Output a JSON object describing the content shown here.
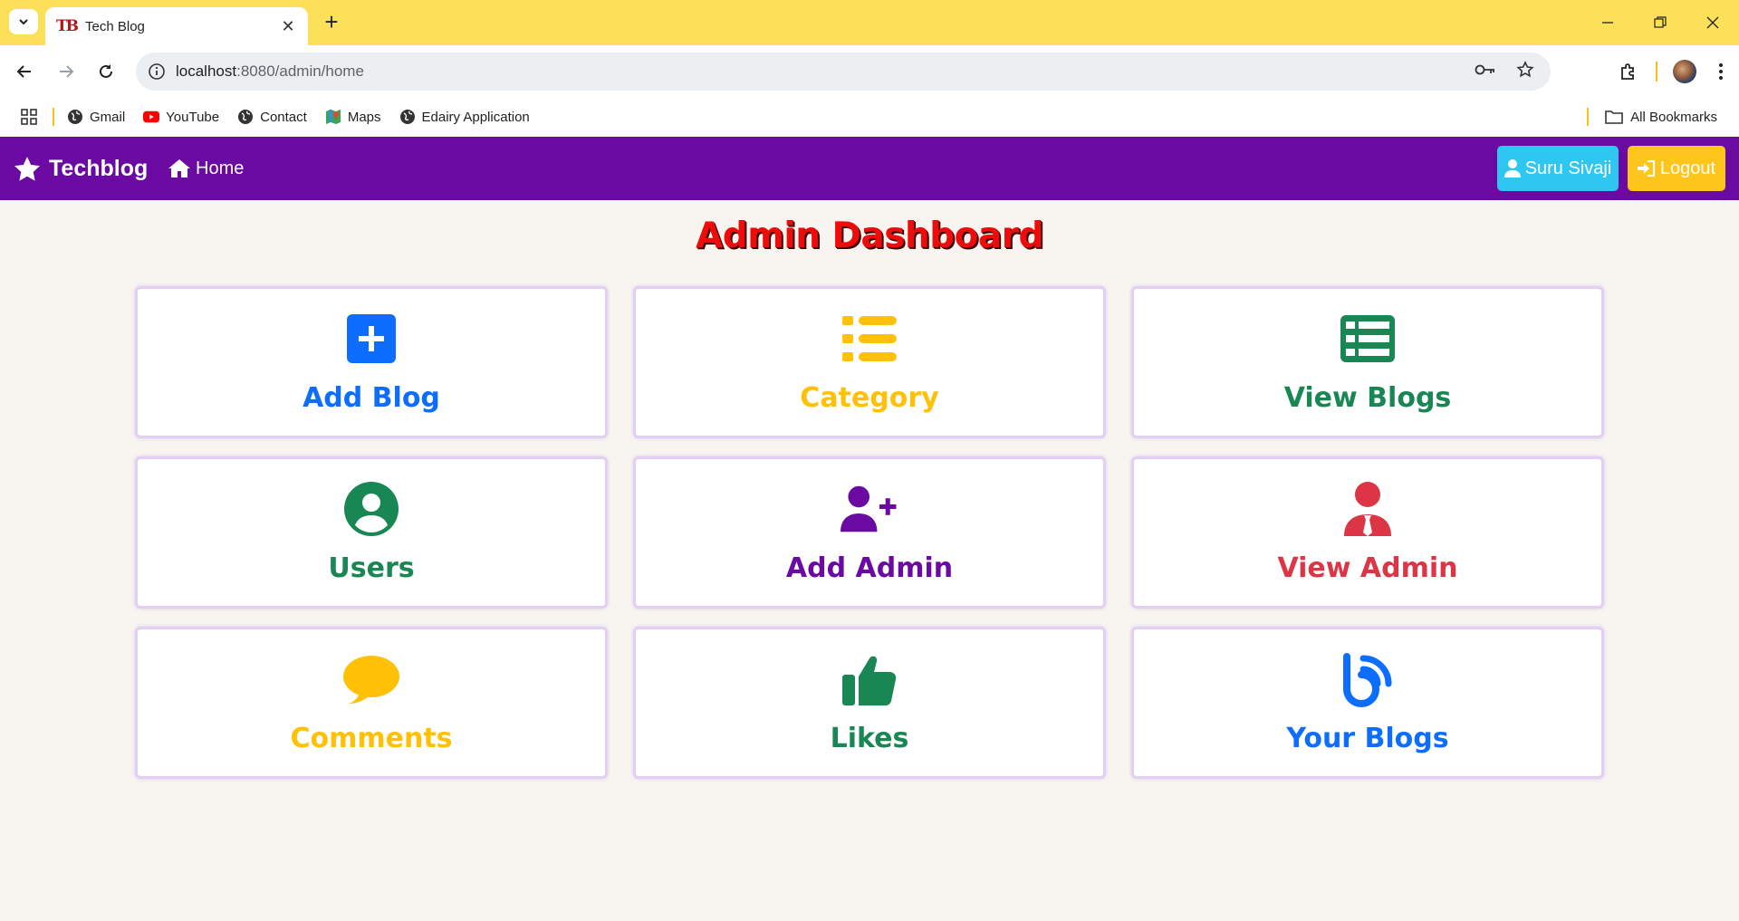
{
  "browser": {
    "tab_title": "Tech Blog",
    "tab_favicon": "TB",
    "url_host": "localhost",
    "url_rest": ":8080/admin/home",
    "bookmarks": [
      {
        "label": "Gmail",
        "icon": "globe-icon"
      },
      {
        "label": "YouTube",
        "icon": "youtube-icon"
      },
      {
        "label": "Contact",
        "icon": "globe-icon"
      },
      {
        "label": "Maps",
        "icon": "maps-icon"
      },
      {
        "label": "Edairy Application",
        "icon": "globe-icon"
      }
    ],
    "all_bookmarks": "All Bookmarks",
    "colors": {
      "tabstrip": "#fde05a"
    }
  },
  "navbar": {
    "brand": "Techblog",
    "home": "Home",
    "user_button": "Suru Sivaji",
    "logout_button": "Logout",
    "colors": {
      "background": "#6a0aa2",
      "user": "#2fc7f0",
      "logout": "#fec51a"
    }
  },
  "page": {
    "title": "Admin Dashboard",
    "title_color": "#ee0b0b"
  },
  "cards": [
    {
      "label": "Add Blog",
      "icon": "plus-square-icon",
      "color": "#0d6efd"
    },
    {
      "label": "Category",
      "icon": "list-icon",
      "color": "#ffc107"
    },
    {
      "label": "View Blogs",
      "icon": "table-list-icon",
      "color": "#198754"
    },
    {
      "label": "Users",
      "icon": "user-circle-icon",
      "color": "#198754"
    },
    {
      "label": "Add Admin",
      "icon": "user-plus-icon",
      "color": "#6a0aa2"
    },
    {
      "label": "View Admin",
      "icon": "user-tie-icon",
      "color": "#dc3545"
    },
    {
      "label": "Comments",
      "icon": "comment-icon",
      "color": "#ffc107"
    },
    {
      "label": "Likes",
      "icon": "thumbs-up-icon",
      "color": "#198754"
    },
    {
      "label": "Your Blogs",
      "icon": "blog-icon",
      "color": "#0d6efd"
    }
  ]
}
